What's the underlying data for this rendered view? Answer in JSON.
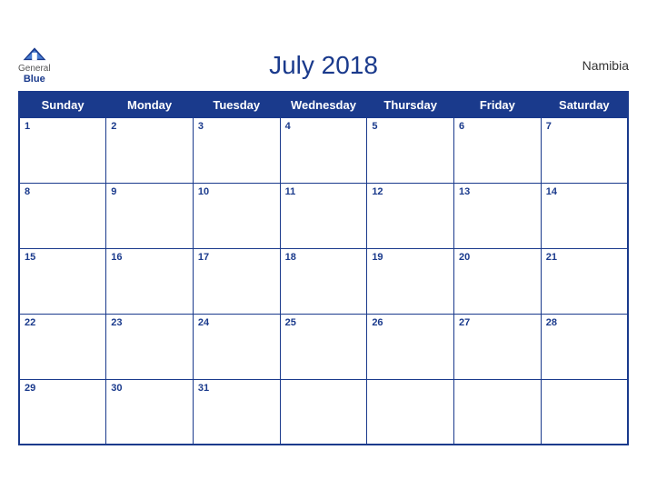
{
  "header": {
    "logo_general": "General",
    "logo_blue": "Blue",
    "title": "July 2018",
    "country": "Namibia"
  },
  "days_of_week": [
    "Sunday",
    "Monday",
    "Tuesday",
    "Wednesday",
    "Thursday",
    "Friday",
    "Saturday"
  ],
  "weeks": [
    [
      {
        "day": 1,
        "empty": false
      },
      {
        "day": 2,
        "empty": false
      },
      {
        "day": 3,
        "empty": false
      },
      {
        "day": 4,
        "empty": false
      },
      {
        "day": 5,
        "empty": false
      },
      {
        "day": 6,
        "empty": false
      },
      {
        "day": 7,
        "empty": false
      }
    ],
    [
      {
        "day": 8,
        "empty": false
      },
      {
        "day": 9,
        "empty": false
      },
      {
        "day": 10,
        "empty": false
      },
      {
        "day": 11,
        "empty": false
      },
      {
        "day": 12,
        "empty": false
      },
      {
        "day": 13,
        "empty": false
      },
      {
        "day": 14,
        "empty": false
      }
    ],
    [
      {
        "day": 15,
        "empty": false
      },
      {
        "day": 16,
        "empty": false
      },
      {
        "day": 17,
        "empty": false
      },
      {
        "day": 18,
        "empty": false
      },
      {
        "day": 19,
        "empty": false
      },
      {
        "day": 20,
        "empty": false
      },
      {
        "day": 21,
        "empty": false
      }
    ],
    [
      {
        "day": 22,
        "empty": false
      },
      {
        "day": 23,
        "empty": false
      },
      {
        "day": 24,
        "empty": false
      },
      {
        "day": 25,
        "empty": false
      },
      {
        "day": 26,
        "empty": false
      },
      {
        "day": 27,
        "empty": false
      },
      {
        "day": 28,
        "empty": false
      }
    ],
    [
      {
        "day": 29,
        "empty": false
      },
      {
        "day": 30,
        "empty": false
      },
      {
        "day": 31,
        "empty": false
      },
      {
        "day": null,
        "empty": true
      },
      {
        "day": null,
        "empty": true
      },
      {
        "day": null,
        "empty": true
      },
      {
        "day": null,
        "empty": true
      }
    ]
  ]
}
